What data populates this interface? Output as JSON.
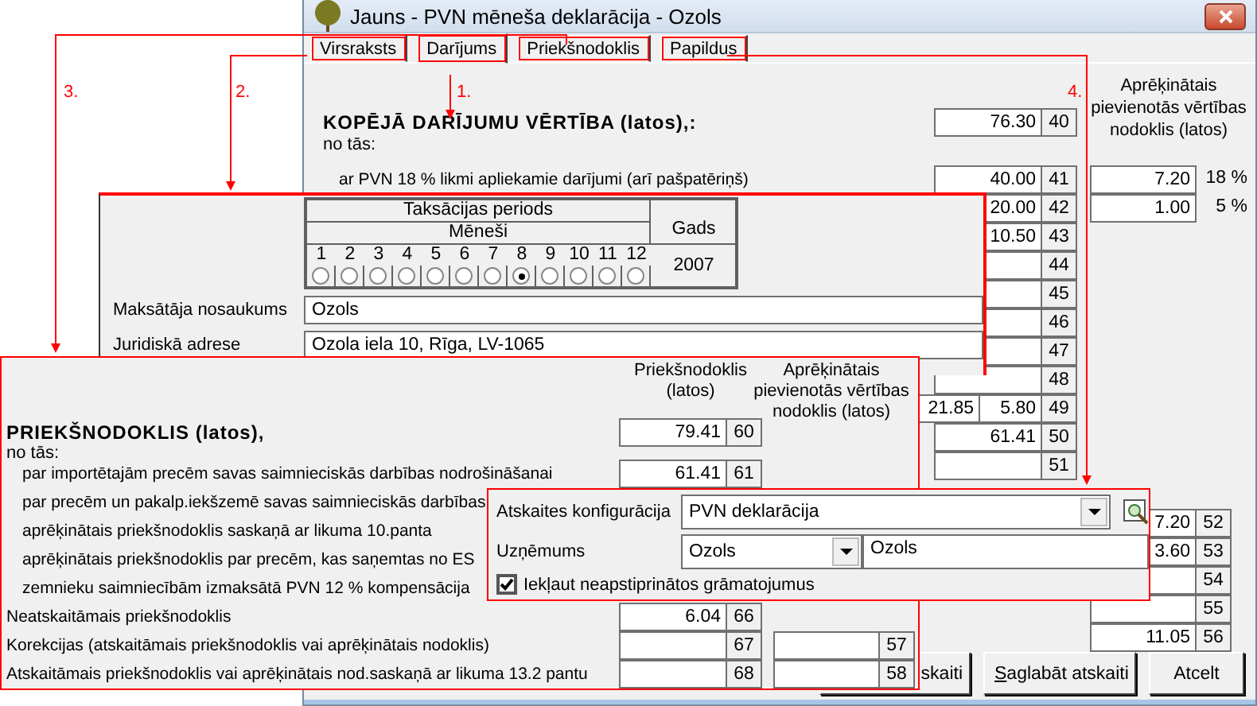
{
  "window": {
    "title": "Jauns - PVN mēneša deklarācija - Ozols"
  },
  "tabs": [
    {
      "label": "Virsraksts",
      "selected": false,
      "annotated": true
    },
    {
      "label": "Darījums",
      "selected": true,
      "annotated": true
    },
    {
      "label": "Priekšnodoklis",
      "selected": false,
      "annotated": true
    },
    {
      "label": "Papildus",
      "selected": false,
      "annotated": true
    }
  ],
  "vat_header": "Aprēķinātais pievienotās vērtības nodoklis (latos)",
  "main_rows": [
    {
      "kind": "total",
      "label": "KOPĒJĀ DARĪJUMU VĒRTĪBA (latos),:",
      "value": "76.30",
      "code": "40"
    },
    {
      "kind": "note",
      "label": "no tās:"
    },
    {
      "kind": "sub",
      "label": "ar PVN 18 % likmi apliekamie darījumi (arī pašpatēriņš)",
      "value": "40.00",
      "code": "41",
      "vat": "7.20",
      "rate": "18 %"
    },
    {
      "kind": "sub",
      "value": "20.00",
      "code": "42",
      "vat": "1.00",
      "rate": "5 %"
    },
    {
      "kind": "sub",
      "value": "10.50",
      "code": "43"
    },
    {
      "kind": "sub",
      "code": "44"
    },
    {
      "kind": "sub",
      "code": "45"
    },
    {
      "kind": "sub",
      "code": "46"
    },
    {
      "kind": "sub",
      "code": "47"
    },
    {
      "kind": "sub",
      "code": "48"
    },
    {
      "kind": "sub",
      "extra": "21.85",
      "value": "5.80",
      "code": "49"
    },
    {
      "kind": "sub",
      "value": "61.41",
      "code": "50"
    },
    {
      "kind": "sub",
      "code": "51"
    }
  ],
  "lower_rows": [
    {
      "value": "7.20",
      "code": "52"
    },
    {
      "value": "3.60",
      "code": "53"
    },
    {
      "code": "54"
    },
    {
      "code": "55"
    },
    {
      "value": "11.05",
      "code": "56"
    }
  ],
  "buttons": [
    {
      "label": "skaiti"
    },
    {
      "label": "Saglabāt atskaiti"
    },
    {
      "label": "Atcelt"
    }
  ],
  "header_panel": {
    "period_title": "Taksācijas periods",
    "months_title": "Mēneši",
    "year_title": "Gads",
    "year": "2007",
    "months": [
      {
        "label": "1",
        "selected": false
      },
      {
        "label": "2",
        "selected": false
      },
      {
        "label": "3",
        "selected": false
      },
      {
        "label": "4",
        "selected": false
      },
      {
        "label": "5",
        "selected": false
      },
      {
        "label": "6",
        "selected": false
      },
      {
        "label": "7",
        "selected": false
      },
      {
        "label": "8",
        "selected": true
      },
      {
        "label": "9",
        "selected": false
      },
      {
        "label": "10",
        "selected": false
      },
      {
        "label": "11",
        "selected": false
      },
      {
        "label": "12",
        "selected": false
      }
    ],
    "fields": [
      {
        "label": "Maksātāja nosaukums",
        "value": "Ozols"
      },
      {
        "label": "Juridiskā adrese",
        "value": "Ozola iela 10, Rīga, LV-1065"
      }
    ]
  },
  "input_tax_panel": {
    "column_1": "Priekšnodoklis (latos)",
    "column_2": "Aprēķinātais pievienotās vērtības nodoklis (latos)",
    "rows": [
      {
        "kind": "total",
        "label": "PRIEKŠNODOKLIS (latos),",
        "value": "79.41",
        "code": "60"
      },
      {
        "kind": "note",
        "label": "no tās:"
      },
      {
        "kind": "sub",
        "label": "par importētajām precēm savas saimnieciskās darbības nodrošināšanai",
        "value": "61.41",
        "code": "61"
      },
      {
        "kind": "sub",
        "label": "par precēm un pakalp.iekšzemē savas saimnieciskās darbības"
      },
      {
        "kind": "sub",
        "label": "aprēķinātais priekšnodoklis saskaņā ar likuma 10.panta"
      },
      {
        "kind": "sub",
        "label": "aprēķinātais priekšnodoklis par precēm, kas saņemtas no ES"
      },
      {
        "kind": "sub",
        "label": "zemnieku saimniecībām izmaksātā PVN 12 % kompensācija"
      },
      {
        "kind": "plain",
        "label": "Neatskaitāmais priekšnodoklis",
        "value": "6.04",
        "code": "66"
      },
      {
        "kind": "plain",
        "label": "Korekcijas (atskaitāmais priekšnodoklis vai aprēķinātais nodoklis)",
        "code": "67",
        "vat_code": "57"
      },
      {
        "kind": "plain",
        "label": "Atskaitāmais priekšnodoklis vai aprēķinātais nod.saskaņā ar likuma 13.2 pantu",
        "code": "68",
        "vat_code": "58"
      }
    ]
  },
  "extra_panel": {
    "config_label": "Atskaites konfigurācija",
    "config_value": "PVN deklarācija",
    "company_label": "Uzņēmums",
    "company_code": "Ozols",
    "company_name": "Ozols",
    "include_label": "Iekļaut neapstiprinātos grāmatojumus",
    "include_checked": true
  },
  "callouts": [
    {
      "label": "3."
    },
    {
      "label": "2."
    },
    {
      "label": "1."
    },
    {
      "label": "4."
    }
  ]
}
